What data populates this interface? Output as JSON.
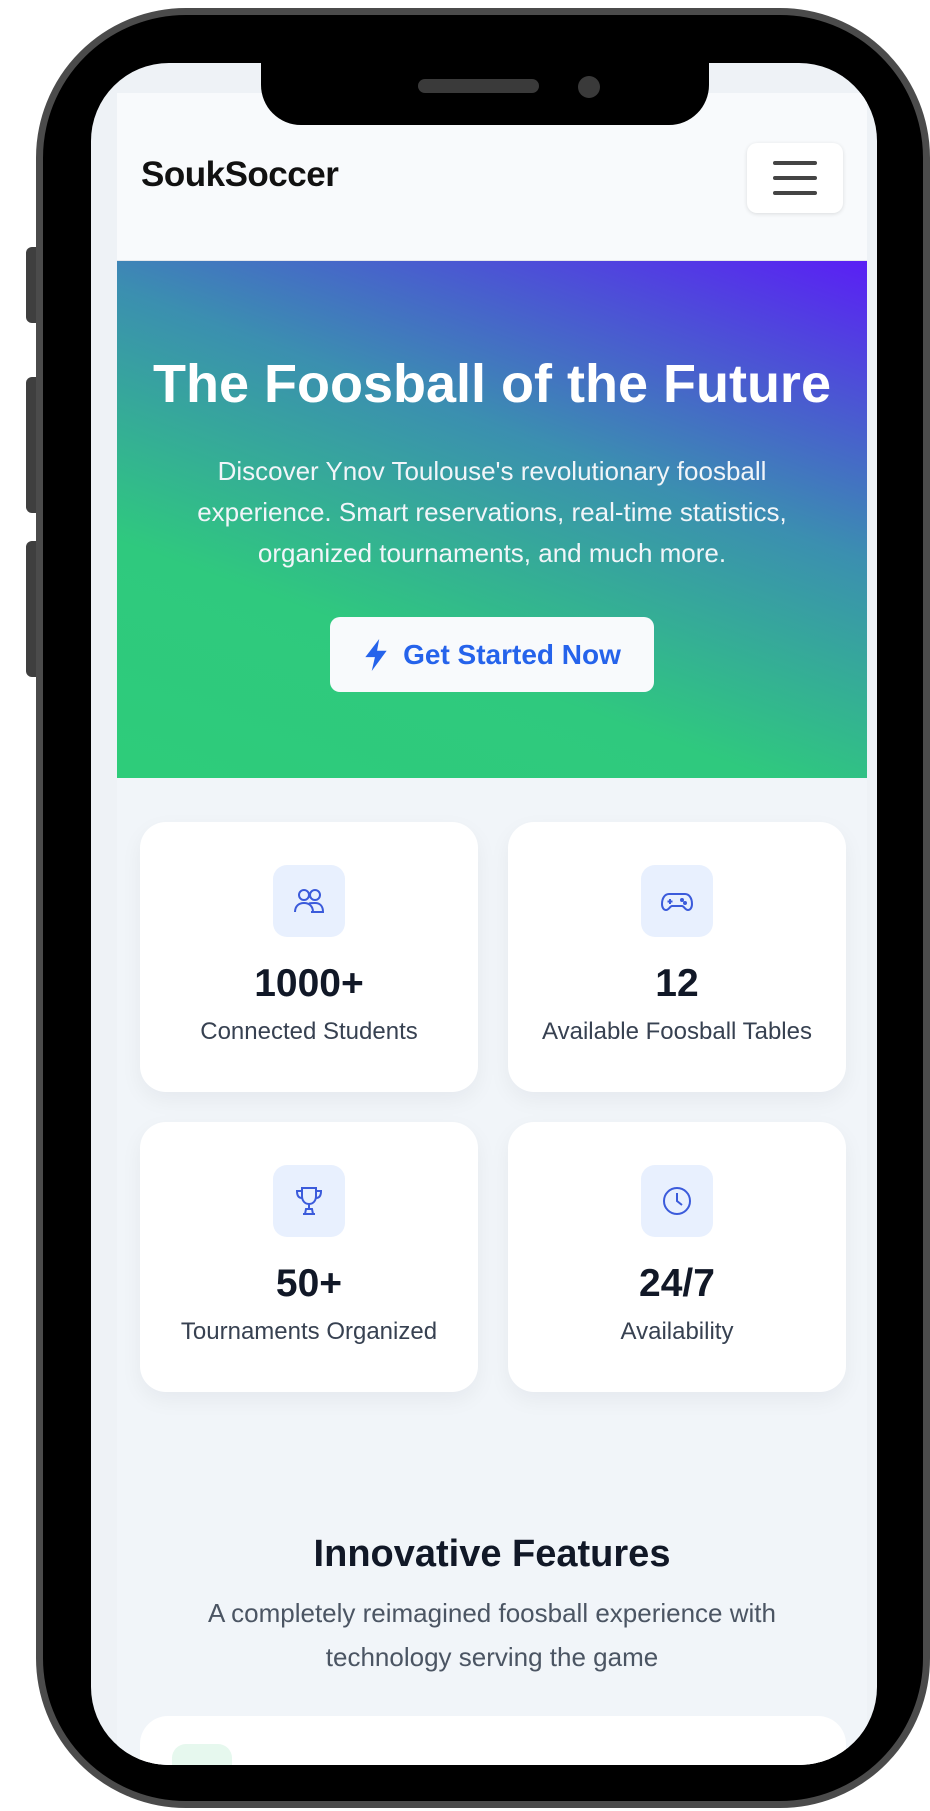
{
  "navbar": {
    "brand": "SoukSoccer"
  },
  "hero": {
    "title": "The Foosball of the Future",
    "subtitle": "Discover Ynov Toulouse's revolutionary foosball experience. Smart reservations, real-time statistics, organized tournaments, and much more.",
    "cta_label": "Get Started Now",
    "cta_icon": "lightning-icon"
  },
  "stats": [
    {
      "icon": "users-icon",
      "value": "1000+",
      "label": "Connected Students"
    },
    {
      "icon": "gamepad-icon",
      "value": "12",
      "label": "Available Foosball Tables"
    },
    {
      "icon": "trophy-icon",
      "value": "50+",
      "label": "Tournaments Organized"
    },
    {
      "icon": "clock-icon",
      "value": "24/7",
      "label": "Availability"
    }
  ],
  "features": {
    "title": "Innovative Features",
    "subtitle": "A completely reimagined foosball experience with technology serving the game"
  },
  "colors": {
    "accent": "#2563eb",
    "gradient_start": "#2ecc7a",
    "gradient_end": "#5a1ff5",
    "icon_bg": "#e8f0fe"
  }
}
